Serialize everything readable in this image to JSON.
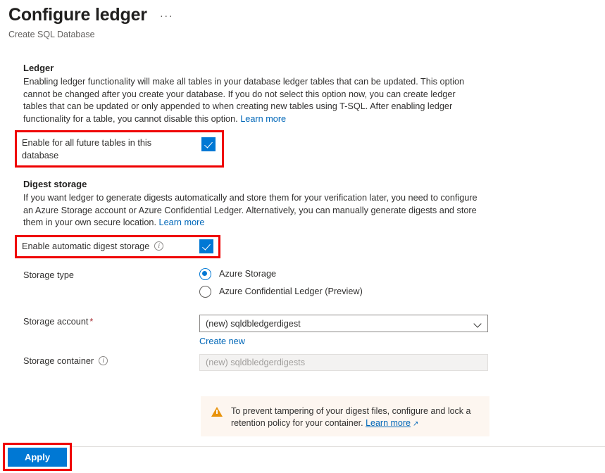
{
  "header": {
    "title": "Configure ledger",
    "subtitle": "Create SQL Database",
    "more_menu": "···"
  },
  "ledger_section": {
    "heading": "Ledger",
    "description": "Enabling ledger functionality will make all tables in your database ledger tables that can be updated. This option cannot be changed after you create your database. If you do not select this option now, you can create ledger tables that can be updated or only appended to when creating new tables using T-SQL. After enabling ledger functionality for a table, you cannot disable this option. ",
    "learn_more": "Learn more",
    "enable_future_tables_label": "Enable for all future tables in this database",
    "enable_future_tables_checked": true
  },
  "digest_section": {
    "heading": "Digest storage",
    "description": "If you want ledger to generate digests automatically and store them for your verification later, you need to configure an Azure Storage account or Azure Confidential Ledger. Alternatively, you can manually generate digests and store them in your own secure location. ",
    "learn_more": "Learn more",
    "enable_auto_digest_label": "Enable automatic digest storage",
    "enable_auto_digest_checked": true,
    "info_glyph": "i"
  },
  "storage_type": {
    "label": "Storage type",
    "options": [
      {
        "label": "Azure Storage",
        "selected": true
      },
      {
        "label": "Azure Confidential Ledger (Preview)",
        "selected": false
      }
    ]
  },
  "storage_account": {
    "label": "Storage account",
    "required_marker": "*",
    "value": "(new) sqldbledgerdigest",
    "create_new_link": "Create new"
  },
  "storage_container": {
    "label": "Storage container",
    "info_glyph": "i",
    "placeholder": "(new) sqldbledgerdigests"
  },
  "banner": {
    "icon": "warning-icon",
    "text": "To prevent tampering of your digest files, configure and lock a retention policy for your container. ",
    "link_text": "Learn more",
    "external_glyph": "↗"
  },
  "footer": {
    "apply_label": "Apply"
  },
  "colors": {
    "accent": "#0078d4",
    "link": "#0067b8",
    "highlight_box": "#ef0000",
    "required": "#a4262c",
    "banner_bg": "#fdf6f0",
    "warning": "#e8930c"
  }
}
